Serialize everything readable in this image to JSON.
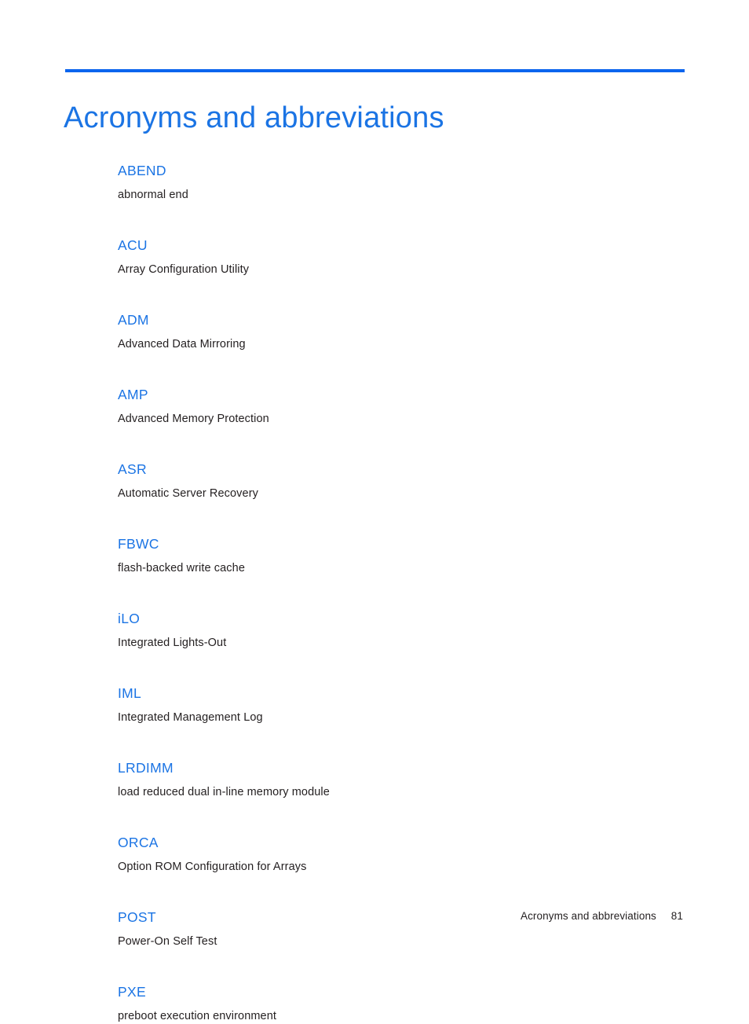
{
  "document": {
    "title": "Acronyms and abbreviations",
    "accent_color": "#1b74e4",
    "rule_color": "#0b65ee",
    "body_text_color": "#231f20",
    "background_color": "#ffffff"
  },
  "glossary": {
    "entries": [
      {
        "term": "ABEND",
        "definition": "abnormal end"
      },
      {
        "term": "ACU",
        "definition": "Array Configuration Utility"
      },
      {
        "term": "ADM",
        "definition": "Advanced Data Mirroring"
      },
      {
        "term": "AMP",
        "definition": "Advanced Memory Protection"
      },
      {
        "term": "ASR",
        "definition": "Automatic Server Recovery"
      },
      {
        "term": "FBWC",
        "definition": "flash-backed write cache"
      },
      {
        "term": "iLO",
        "definition": "Integrated Lights-Out"
      },
      {
        "term": "IML",
        "definition": "Integrated Management Log"
      },
      {
        "term": "LRDIMM",
        "definition": "load reduced dual in-line memory module"
      },
      {
        "term": "ORCA",
        "definition": "Option ROM Configuration for Arrays"
      },
      {
        "term": "POST",
        "definition": "Power-On Self Test"
      },
      {
        "term": "PXE",
        "definition": "preboot execution environment"
      }
    ]
  },
  "footer": {
    "section_label": "Acronyms and abbreviations",
    "page_number": "81"
  }
}
